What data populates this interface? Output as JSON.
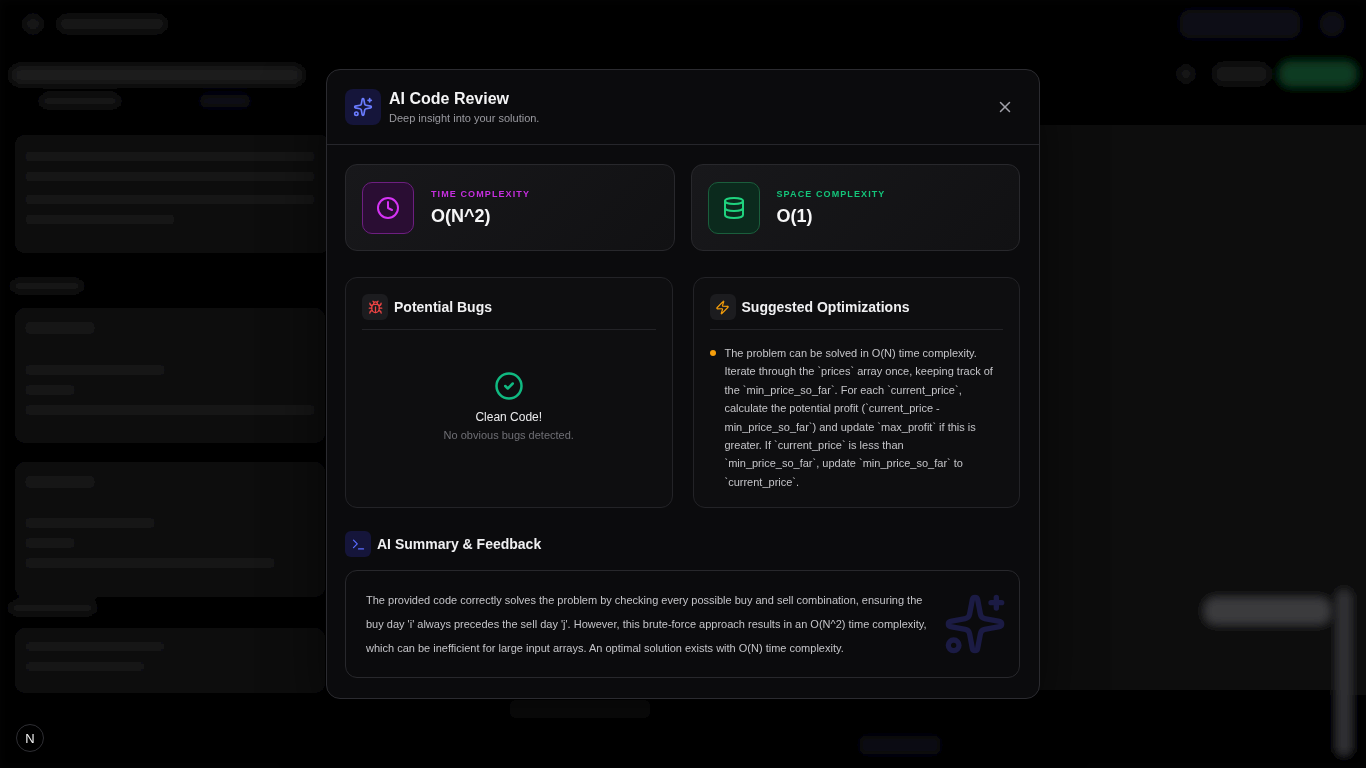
{
  "dialog": {
    "title": "AI Code Review",
    "subtitle": "Deep insight into your solution."
  },
  "complexity": [
    {
      "kind": "time",
      "label": "TIME COMPLEXITY",
      "value": "O(N^2)"
    },
    {
      "kind": "space",
      "label": "SPACE COMPLEXITY",
      "value": "O(1)"
    }
  ],
  "bugs": {
    "title": "Potential Bugs",
    "empty_title": "Clean Code!",
    "empty_text": "No obvious bugs detected."
  },
  "optimizations": {
    "title": "Suggested Optimizations",
    "items": [
      "The problem can be solved in O(N) time complexity. Iterate through the `prices` array once, keeping track of the `min_price_so_far`. For each `current_price`, calculate the potential profit (`current_price - min_price_so_far`) and update `max_profit` if this is greater. If `current_price` is less than `min_price_so_far`, update `min_price_so_far` to `current_price`."
    ]
  },
  "summary": {
    "title": "AI Summary & Feedback",
    "text": "The provided code correctly solves the problem by checking every possible buy and sell combination, ensuring the buy day 'i' always precedes the sell day 'j'. However, this brute-force approach results in an O(N^2) time complexity, which can be inefficient for large input arrays. An optimal solution exists with O(N) time complexity."
  },
  "corner_button": {
    "label": "N"
  }
}
